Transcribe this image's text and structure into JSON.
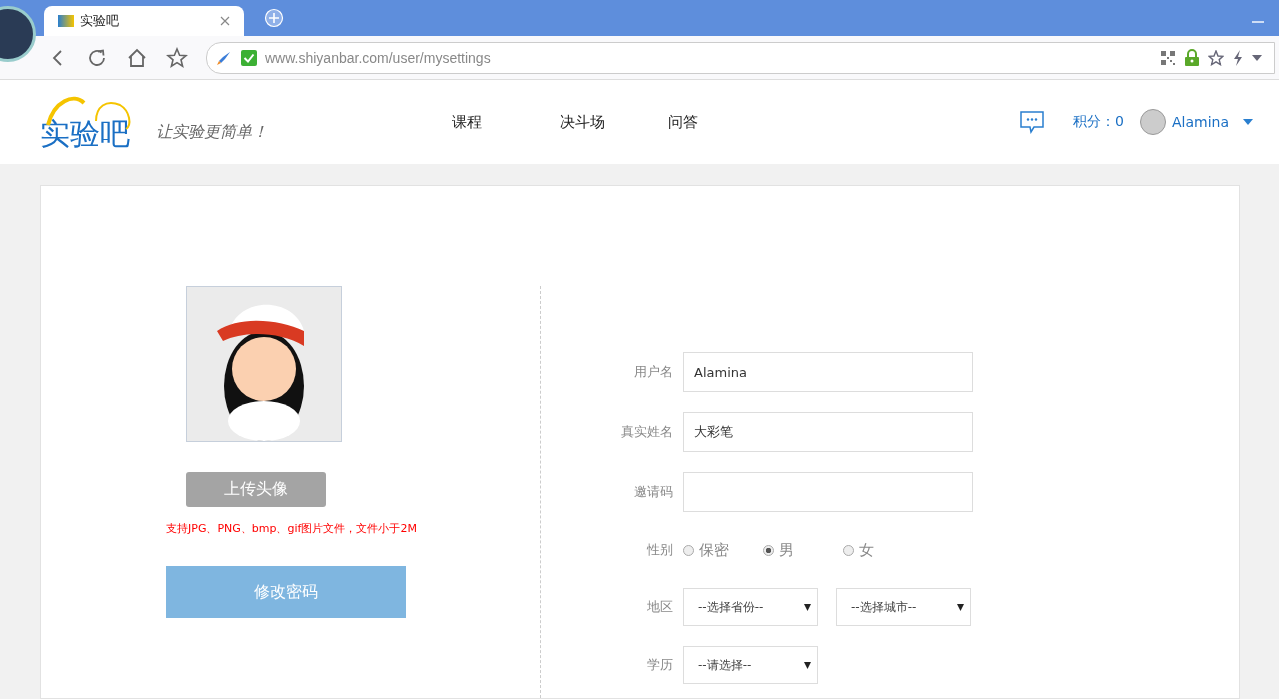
{
  "browser": {
    "tab": {
      "title": "实验吧",
      "selected": true
    },
    "url": {
      "host": "www.shiyanbar.com",
      "path": "/user/mysettings"
    }
  },
  "header": {
    "logo": "实验吧",
    "slogan": "让实验更简单！",
    "nav": [
      {
        "label": "课程"
      },
      {
        "label": "决斗场"
      },
      {
        "label": "问答"
      }
    ],
    "points": "积分：0",
    "user": "Alamina"
  },
  "profile": {
    "upload_button": "上传头像",
    "note": "支持JPG、PNG、bmp、gif图片文件，文件小于2M",
    "password_button": "修改密码"
  },
  "form": {
    "fields": [
      {
        "label": "用户名",
        "value": "Alamina"
      },
      {
        "label": "真实姓名",
        "value": "大彩笔"
      },
      {
        "label": "邀请码"
      }
    ],
    "gender": {
      "label": "性别",
      "options": [
        {
          "label": "保密",
          "selected": false
        },
        {
          "label": "男",
          "selected": true
        },
        {
          "label": "女",
          "selected": false
        }
      ]
    },
    "region": {
      "label": "地区",
      "selects": [
        "--选择省份--",
        "--选择城市--"
      ]
    },
    "education": {
      "label": "学历",
      "select": "--请选择--"
    }
  }
}
